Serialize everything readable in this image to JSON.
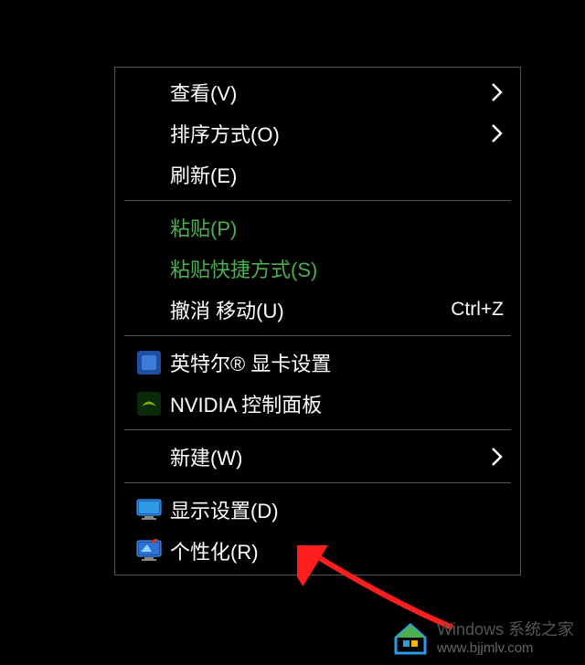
{
  "menu": {
    "view": {
      "label": "查看(V)",
      "has_submenu": true
    },
    "sort": {
      "label": "排序方式(O)",
      "has_submenu": true
    },
    "refresh": {
      "label": "刷新(E)"
    },
    "paste": {
      "label": "粘贴(P)",
      "disabled": true
    },
    "paste_shortcut": {
      "label": "粘贴快捷方式(S)",
      "disabled": true
    },
    "undo": {
      "label": "撤消 移动(U)",
      "shortcut": "Ctrl+Z"
    },
    "intel": {
      "label": "英特尔® 显卡设置",
      "icon": "intel-icon"
    },
    "nvidia": {
      "label": "NVIDIA 控制面板",
      "icon": "nvidia-icon"
    },
    "new": {
      "label": "新建(W)",
      "has_submenu": true
    },
    "display": {
      "label": "显示设置(D)",
      "icon": "monitor-icon"
    },
    "personalize": {
      "label": "个性化(R)",
      "icon": "personalize-icon"
    }
  },
  "watermark": {
    "line1": "Windows 系统之家",
    "line2": "www.bjjmlv.com"
  },
  "annotation": {
    "target": "个性化(R)"
  }
}
